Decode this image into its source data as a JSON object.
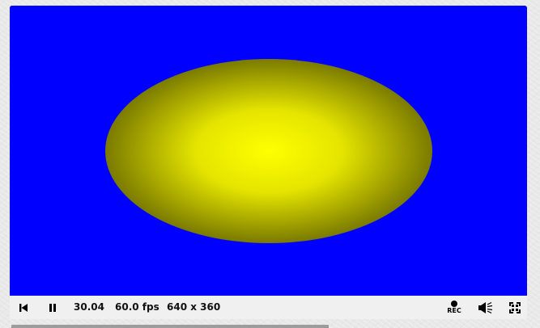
{
  "canvas": {
    "background_color": "#0000ff",
    "shape": "ellipse",
    "shape_center_color": "#ffff00",
    "shape_edge_color": "#7a7a00"
  },
  "controls": {
    "rewind_icon": "skip-to-start-icon",
    "pause_icon": "pause-icon",
    "time": "30.04",
    "fps": "60.0 fps",
    "resolution": "640 x 360",
    "record_label": "REC",
    "record_icon": "record-dot-icon",
    "volume_icon": "speaker-volume-icon",
    "fullscreen_icon": "fullscreen-icon"
  }
}
